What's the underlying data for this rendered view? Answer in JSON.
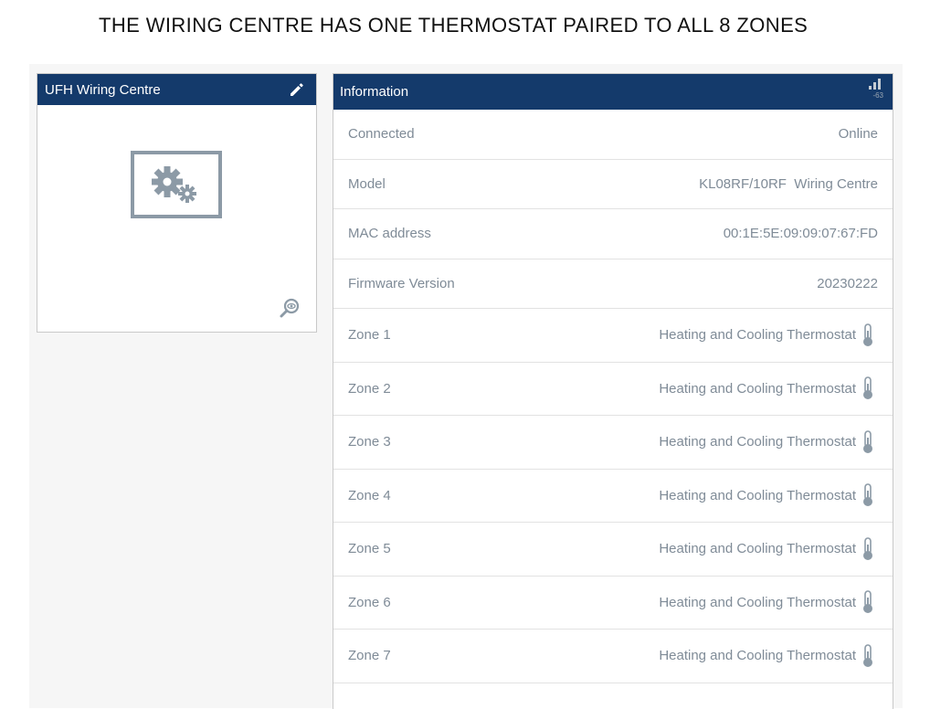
{
  "heading": "THE WIRING CENTRE HAS ONE THERMOSTAT PAIRED TO ALL 8 ZONES",
  "device_card": {
    "title": "UFH Wiring Centre",
    "icons": [
      "edit-icon",
      "gear-device-icon",
      "zoom-view-icon"
    ]
  },
  "info": {
    "title": "Information",
    "signal_value": "-63",
    "rows": [
      {
        "label": "Connected",
        "value": "Online"
      },
      {
        "label": "Model",
        "value": "KL08RF/10RF  Wiring Centre"
      },
      {
        "label": "MAC address",
        "value": "00:1E:5E:09:09:07:67:FD"
      },
      {
        "label": "Firmware Version",
        "value": "20230222"
      }
    ],
    "zones": [
      {
        "label": "Zone 1",
        "value": "Heating and Cooling Thermostat"
      },
      {
        "label": "Zone 2",
        "value": "Heating and Cooling Thermostat"
      },
      {
        "label": "Zone 3",
        "value": "Heating and Cooling Thermostat"
      },
      {
        "label": "Zone 4",
        "value": "Heating and Cooling Thermostat"
      },
      {
        "label": "Zone 5",
        "value": "Heating and Cooling Thermostat"
      },
      {
        "label": "Zone 6",
        "value": "Heating and Cooling Thermostat"
      },
      {
        "label": "Zone 7",
        "value": "Heating and Cooling Thermostat"
      }
    ]
  },
  "colors": {
    "header_bg": "#143a6b",
    "text_muted": "#7f8b97",
    "icon_grey": "#8c9aa6"
  }
}
